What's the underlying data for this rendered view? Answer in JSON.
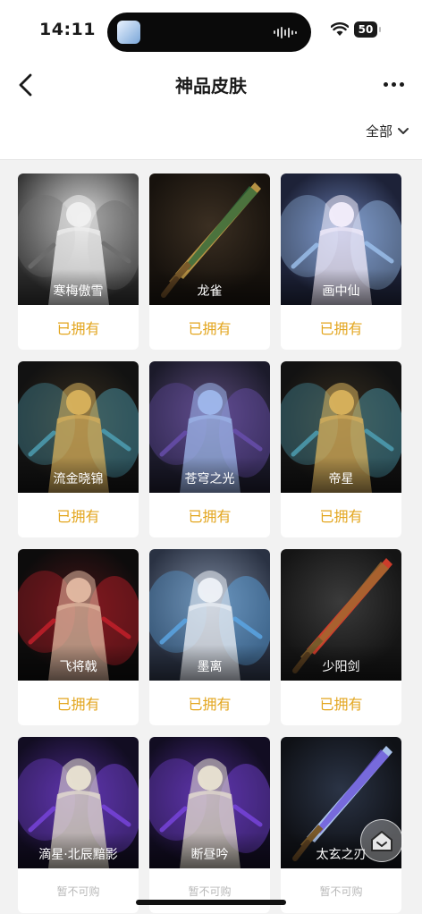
{
  "status_bar": {
    "time": "14:11",
    "battery": "50"
  },
  "header": {
    "title": "神品皮肤"
  },
  "filter": {
    "label": "全部"
  },
  "colors": {
    "owned": "#e3a61f",
    "unavailable": "#b8b8b8"
  },
  "skins": [
    {
      "name": "寒梅傲雪",
      "status": "已拥有",
      "owned": true,
      "art": "swordsman-white"
    },
    {
      "name": "龙雀",
      "status": "已拥有",
      "owned": true,
      "art": "sword-gold"
    },
    {
      "name": "画中仙",
      "status": "已拥有",
      "owned": true,
      "art": "fairy-white"
    },
    {
      "name": "流金晓锦",
      "status": "已拥有",
      "owned": true,
      "art": "warrior-gold"
    },
    {
      "name": "苍穹之光",
      "status": "已拥有",
      "owned": true,
      "art": "mage-blue"
    },
    {
      "name": "帝星",
      "status": "已拥有",
      "owned": true,
      "art": "warrior-gold"
    },
    {
      "name": "飞将戟",
      "status": "已拥有",
      "owned": true,
      "art": "warrior-red"
    },
    {
      "name": "墨离",
      "status": "已拥有",
      "owned": true,
      "art": "lady-silver"
    },
    {
      "name": "少阳剑",
      "status": "已拥有",
      "owned": true,
      "art": "sword-red"
    },
    {
      "name": "滴星·北辰黯影",
      "status": "暂不可购",
      "owned": false,
      "art": "lady-purple"
    },
    {
      "name": "断昼吟",
      "status": "暂不可购",
      "owned": false,
      "art": "lady-purple"
    },
    {
      "name": "太玄之刃",
      "status": "暂不可购",
      "owned": false,
      "art": "sword-blue"
    }
  ]
}
